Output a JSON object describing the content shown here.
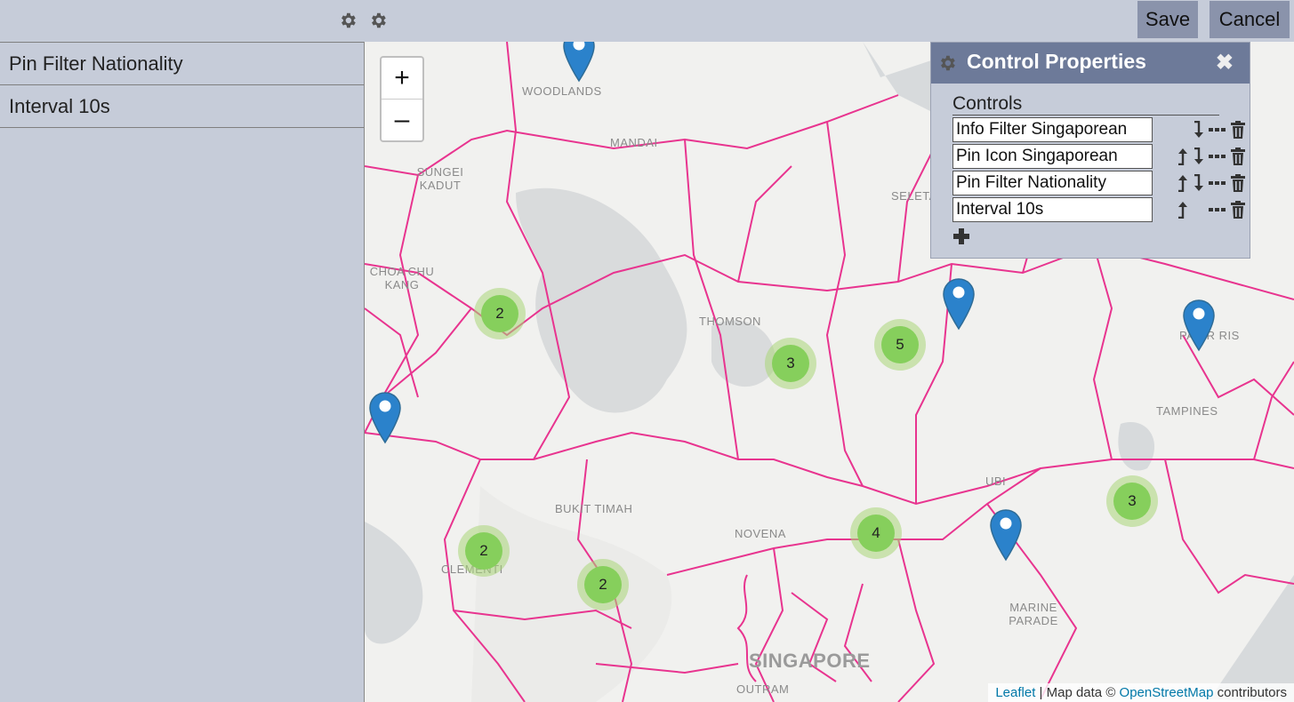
{
  "toolbar": {
    "save_label": "Save",
    "cancel_label": "Cancel"
  },
  "sidebar": {
    "items": [
      {
        "label": "Pin Filter Nationality"
      },
      {
        "label": "Interval 10s"
      }
    ]
  },
  "map": {
    "zoom_in": "+",
    "zoom_out": "–",
    "labels": [
      "WOODLANDS",
      "MANDAI",
      "SUNGEI KADUT",
      "SELETAR",
      "CHOA CHU KANG",
      "THOMSON",
      "PASIR RIS",
      "TAMPINES",
      "BUKIT TIMAH",
      "NOVENA",
      "UBI",
      "CLEMENTI",
      "MARINE PARADE",
      "SINGAPORE",
      "OUTRAM"
    ],
    "clusters": [
      "2",
      "3",
      "5",
      "3",
      "2",
      "2",
      "4"
    ],
    "attribution": {
      "leaflet": "Leaflet",
      "sep": " | Map data © ",
      "osm": "OpenStreetMap",
      "suffix": " contributors"
    }
  },
  "panel": {
    "title": "Control Properties",
    "close": "✖",
    "controls_label": "Controls",
    "rows": [
      {
        "label": "Info Filter Singaporean"
      },
      {
        "label": "Pin Icon Singaporean"
      },
      {
        "label": "Pin Filter Nationality"
      },
      {
        "label": "Interval 10s"
      }
    ]
  },
  "colors": {
    "accent": "#6d7a99",
    "button": "#8a93ab",
    "background": "#c6ccd9",
    "roads": "#e8348f",
    "cluster": "#86cf5c",
    "pin": "#2b82cb"
  }
}
